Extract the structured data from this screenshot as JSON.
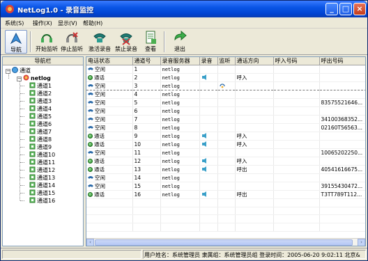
{
  "window": {
    "title": "NetLog1.0 - 录音监控",
    "minimize": "_",
    "maximize": "□",
    "close": "×"
  },
  "menu": [
    "系统(S)",
    "操作(X)",
    "显示(V)",
    "帮助(H)"
  ],
  "toolbar": {
    "nav": "导航",
    "start_monitor": "开始监听",
    "stop_monitor": "停止监听",
    "activate_record": "激活录音",
    "disable_record": "禁止录音",
    "view": "查看",
    "exit": "退出"
  },
  "navpane": {
    "header": "导航栏",
    "root": "通道",
    "server": "netlog",
    "channels": [
      "通道1",
      "通道2",
      "通道3",
      "通道4",
      "通道5",
      "通道6",
      "通道7",
      "通道8",
      "通道9",
      "通道10",
      "通道11",
      "通道12",
      "通道13",
      "通道14",
      "通道15",
      "通道16"
    ]
  },
  "grid": {
    "columns": [
      "电话状态",
      "通道号",
      "录音服务器",
      "录音",
      "监听",
      "通话方向",
      "呼入号码",
      "呼出号码"
    ],
    "rows": [
      {
        "status": "空闲",
        "state": "idle",
        "ch": "1",
        "server": "netlog",
        "rec": false,
        "mon": false,
        "dir": "",
        "in": "",
        "out": ""
      },
      {
        "status": "通话",
        "state": "talk",
        "ch": "2",
        "server": "netlog",
        "rec": true,
        "mon": false,
        "dir": "呼入",
        "in": "",
        "out": ""
      },
      {
        "status": "空闲",
        "state": "idle",
        "ch": "3",
        "server": "netlog",
        "rec": false,
        "mon": true,
        "dir": "",
        "in": "",
        "out": ""
      },
      {
        "status": "空闲",
        "state": "idle",
        "ch": "4",
        "server": "netlog",
        "rec": false,
        "mon": false,
        "dir": "",
        "in": "",
        "out": ""
      },
      {
        "status": "空闲",
        "state": "idle",
        "ch": "5",
        "server": "netlog",
        "rec": false,
        "mon": false,
        "dir": "",
        "in": "",
        "out": "83575521646..."
      },
      {
        "status": "空闲",
        "state": "idle",
        "ch": "6",
        "server": "netlog",
        "rec": false,
        "mon": false,
        "dir": "",
        "in": "",
        "out": ""
      },
      {
        "status": "空闲",
        "state": "idle",
        "ch": "7",
        "server": "netlog",
        "rec": false,
        "mon": false,
        "dir": "",
        "in": "",
        "out": "34100368352..."
      },
      {
        "status": "空闲",
        "state": "idle",
        "ch": "8",
        "server": "netlog",
        "rec": false,
        "mon": false,
        "dir": "",
        "in": "",
        "out": "02160T56563..."
      },
      {
        "status": "通话",
        "state": "talk",
        "ch": "9",
        "server": "netlog",
        "rec": true,
        "mon": false,
        "dir": "呼入",
        "in": "",
        "out": ""
      },
      {
        "status": "通话",
        "state": "talk",
        "ch": "10",
        "server": "netlog",
        "rec": true,
        "mon": false,
        "dir": "呼入",
        "in": "",
        "out": ""
      },
      {
        "status": "空闲",
        "state": "idle",
        "ch": "11",
        "server": "netlog",
        "rec": false,
        "mon": false,
        "dir": "",
        "in": "",
        "out": "10065202250..."
      },
      {
        "status": "通话",
        "state": "talk",
        "ch": "12",
        "server": "netlog",
        "rec": true,
        "mon": false,
        "dir": "呼入",
        "in": "",
        "out": ""
      },
      {
        "status": "通话",
        "state": "talk",
        "ch": "13",
        "server": "netlog",
        "rec": true,
        "mon": false,
        "dir": "呼出",
        "in": "",
        "out": "40541616675..."
      },
      {
        "status": "空闲",
        "state": "idle",
        "ch": "14",
        "server": "netlog",
        "rec": false,
        "mon": false,
        "dir": "",
        "in": "",
        "out": ""
      },
      {
        "status": "空闲",
        "state": "idle",
        "ch": "15",
        "server": "netlog",
        "rec": false,
        "mon": false,
        "dir": "",
        "in": "",
        "out": "39155430472..."
      },
      {
        "status": "通话",
        "state": "talk",
        "ch": "16",
        "server": "netlog",
        "rec": true,
        "mon": false,
        "dir": "呼出",
        "in": "",
        "out": "T3TT789T112..."
      }
    ]
  },
  "status": "用户姓名：系统管理员 隶属组：系统管理员组 登录时间：2005-06-20 9:02:11 北京&",
  "colors": {
    "titlebar": "#0a55e5",
    "talk": "#1f8a1f",
    "accent": "#7f9db9"
  }
}
